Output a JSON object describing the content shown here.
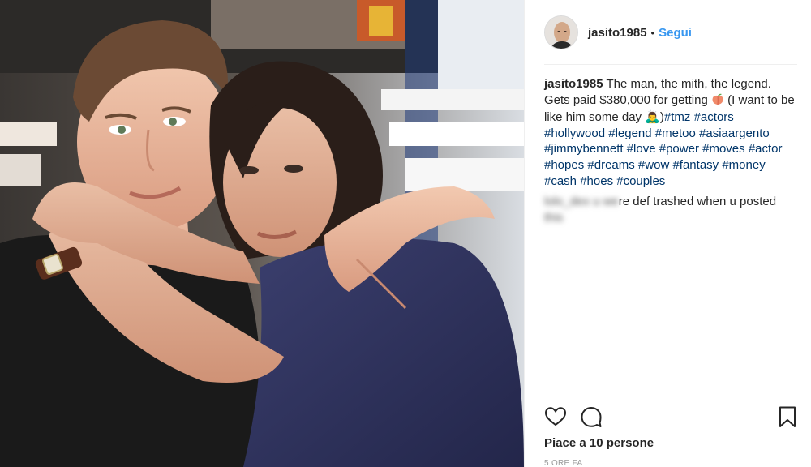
{
  "post": {
    "username": "jasito1985",
    "separator": "•",
    "follow_label": "Segui",
    "caption": {
      "text_1": "The man, the mith, the legend. Gets paid $380,000 for getting ",
      "emoji_1": "peach-emoji",
      "text_2": "  (I want to be like him some day ",
      "emoji_2": "🙇‍♂️",
      "hashtags": [
        "#tmz",
        "#actors",
        "#hollywood",
        "#legend",
        "#metoo",
        "#asiaargento",
        "#jimmybennett",
        "#love",
        "#power",
        "#moves",
        "#actor",
        "#hopes",
        "#dreams",
        "#wow",
        "#fantasy",
        "#money",
        "#cash",
        "#hoes",
        "#couples"
      ]
    },
    "comment": {
      "username_blurred": "lolo_dex",
      "text_prefix_blurred": "u we",
      "text": "re def trashed when u posted",
      "text_line2_blurred": "this"
    },
    "likes_label": "Piace a 10 persone",
    "time_label": "5 ORE FA"
  },
  "icons": {
    "like": "heart-outline-icon",
    "comment": "comment-bubble-icon",
    "save": "bookmark-icon"
  },
  "colors": {
    "follow": "#3897f0",
    "hashtag": "#003569",
    "text": "#262626",
    "muted": "#999999",
    "divider": "#efefef"
  }
}
